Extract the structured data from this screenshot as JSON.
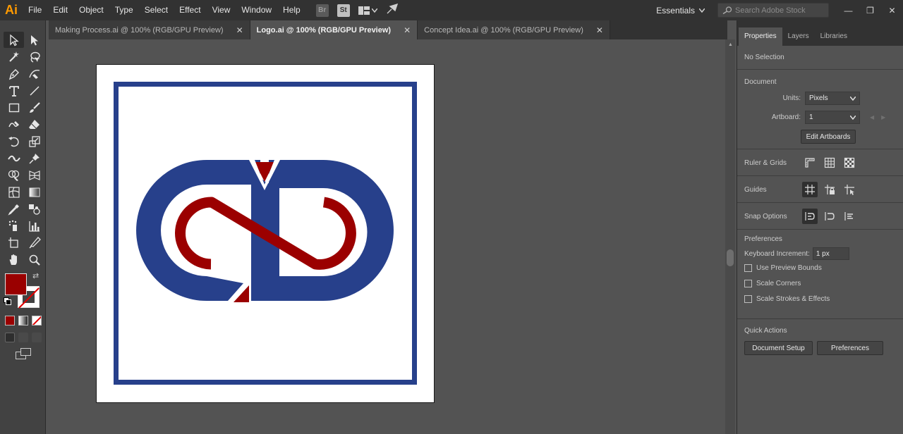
{
  "app": {
    "logo": "Ai"
  },
  "menu": [
    "File",
    "Edit",
    "Object",
    "Type",
    "Select",
    "Effect",
    "View",
    "Window",
    "Help"
  ],
  "toolbar_icons": {
    "bridge": "Br",
    "stock": "St"
  },
  "workspace": {
    "label": "Essentials"
  },
  "search": {
    "placeholder": "Search Adobe Stock"
  },
  "window_controls": {
    "minimize": "—",
    "restore": "❐",
    "close": "✕"
  },
  "tabs": [
    {
      "label": "Making Process.ai @ 100% (RGB/GPU Preview)",
      "active": false
    },
    {
      "label": "Logo.ai @ 100% (RGB/GPU Preview)",
      "active": true
    },
    {
      "label": "Concept Idea.ai @ 100% (RGB/GPU Preview)",
      "active": false
    }
  ],
  "colors": {
    "fill": "#9a0000",
    "logo_blue": "#27408b",
    "logo_red": "#9b0000"
  },
  "panel": {
    "tabs": [
      "Properties",
      "Layers",
      "Libraries"
    ],
    "selection": "No Selection",
    "document": {
      "title": "Document",
      "units_label": "Units:",
      "units_value": "Pixels",
      "artboard_label": "Artboard:",
      "artboard_value": "1",
      "edit_artboards": "Edit Artboards"
    },
    "ruler_grids": "Ruler & Grids",
    "guides": "Guides",
    "snap_options": "Snap Options",
    "preferences": {
      "title": "Preferences",
      "keyboard_increment_label": "Keyboard Increment:",
      "keyboard_increment_value": "1 px",
      "use_preview_bounds": "Use Preview Bounds",
      "scale_corners": "Scale Corners",
      "scale_strokes_effects": "Scale Strokes & Effects"
    },
    "quick_actions": {
      "title": "Quick Actions",
      "document_setup": "Document Setup",
      "preferences": "Preferences"
    }
  }
}
